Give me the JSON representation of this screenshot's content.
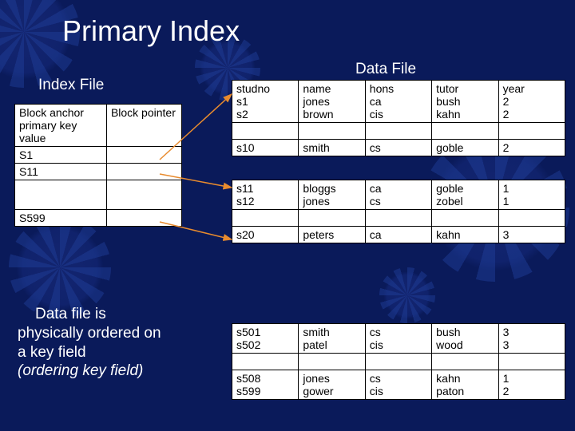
{
  "title": "Primary Index",
  "labels": {
    "index_file": "Index File",
    "data_file": "Data File"
  },
  "caption": {
    "line1": "Data file is",
    "line2": "physically ordered on",
    "line3": "a key field",
    "line4": "(ordering key field)"
  },
  "index_table": {
    "header": [
      "Block anchor primary key value",
      "Block pointer"
    ],
    "rows": [
      [
        "S1",
        ""
      ],
      [
        "S11",
        ""
      ]
    ],
    "after_gap_row": [
      "S599",
      ""
    ]
  },
  "data_file": {
    "header": [
      "studno",
      "name",
      "hons",
      "tutor",
      "year"
    ],
    "block1": [
      [
        "s1",
        "jones",
        "ca",
        "bush",
        "2"
      ],
      [
        "s2",
        "brown",
        "cis",
        "kahn",
        "2"
      ]
    ],
    "block1_last": [
      "s10",
      "smith",
      "cs",
      "goble",
      "2"
    ],
    "block2": [
      [
        "s11",
        "bloggs",
        "ca",
        "goble",
        "1"
      ],
      [
        "s12",
        "jones",
        "cs",
        "zobel",
        "1"
      ]
    ],
    "block2_last": [
      "s20",
      "peters",
      "ca",
      "kahn",
      "3"
    ],
    "block3": [
      [
        "s501",
        "smith",
        "cs",
        "bush",
        "3"
      ],
      [
        "s502",
        "patel",
        "cis",
        "wood",
        "3"
      ]
    ],
    "block3_last": [
      [
        "s508",
        "jones",
        "cs",
        "kahn",
        "1"
      ],
      [
        "s599",
        "gower",
        "cis",
        "paton",
        "2"
      ]
    ]
  },
  "chart_data": {
    "type": "table",
    "title": "Primary Index",
    "description": "Index File entries point to blocks of a Data File physically ordered on primary key studno",
    "index_entries": [
      "S1",
      "S11",
      "S599"
    ],
    "data_records": [
      {
        "studno": "s1",
        "name": "jones",
        "hons": "ca",
        "tutor": "bush",
        "year": 2
      },
      {
        "studno": "s2",
        "name": "brown",
        "hons": "cis",
        "tutor": "kahn",
        "year": 2
      },
      {
        "studno": "s10",
        "name": "smith",
        "hons": "cs",
        "tutor": "goble",
        "year": 2
      },
      {
        "studno": "s11",
        "name": "bloggs",
        "hons": "ca",
        "tutor": "goble",
        "year": 1
      },
      {
        "studno": "s12",
        "name": "jones",
        "hons": "cs",
        "tutor": "zobel",
        "year": 1
      },
      {
        "studno": "s20",
        "name": "peters",
        "hons": "ca",
        "tutor": "kahn",
        "year": 3
      },
      {
        "studno": "s501",
        "name": "smith",
        "hons": "cs",
        "tutor": "bush",
        "year": 3
      },
      {
        "studno": "s502",
        "name": "patel",
        "hons": "cis",
        "tutor": "wood",
        "year": 3
      },
      {
        "studno": "s508",
        "name": "jones",
        "hons": "cs",
        "tutor": "kahn",
        "year": 1
      },
      {
        "studno": "s599",
        "name": "gower",
        "hons": "cis",
        "tutor": "paton",
        "year": 2
      }
    ]
  }
}
